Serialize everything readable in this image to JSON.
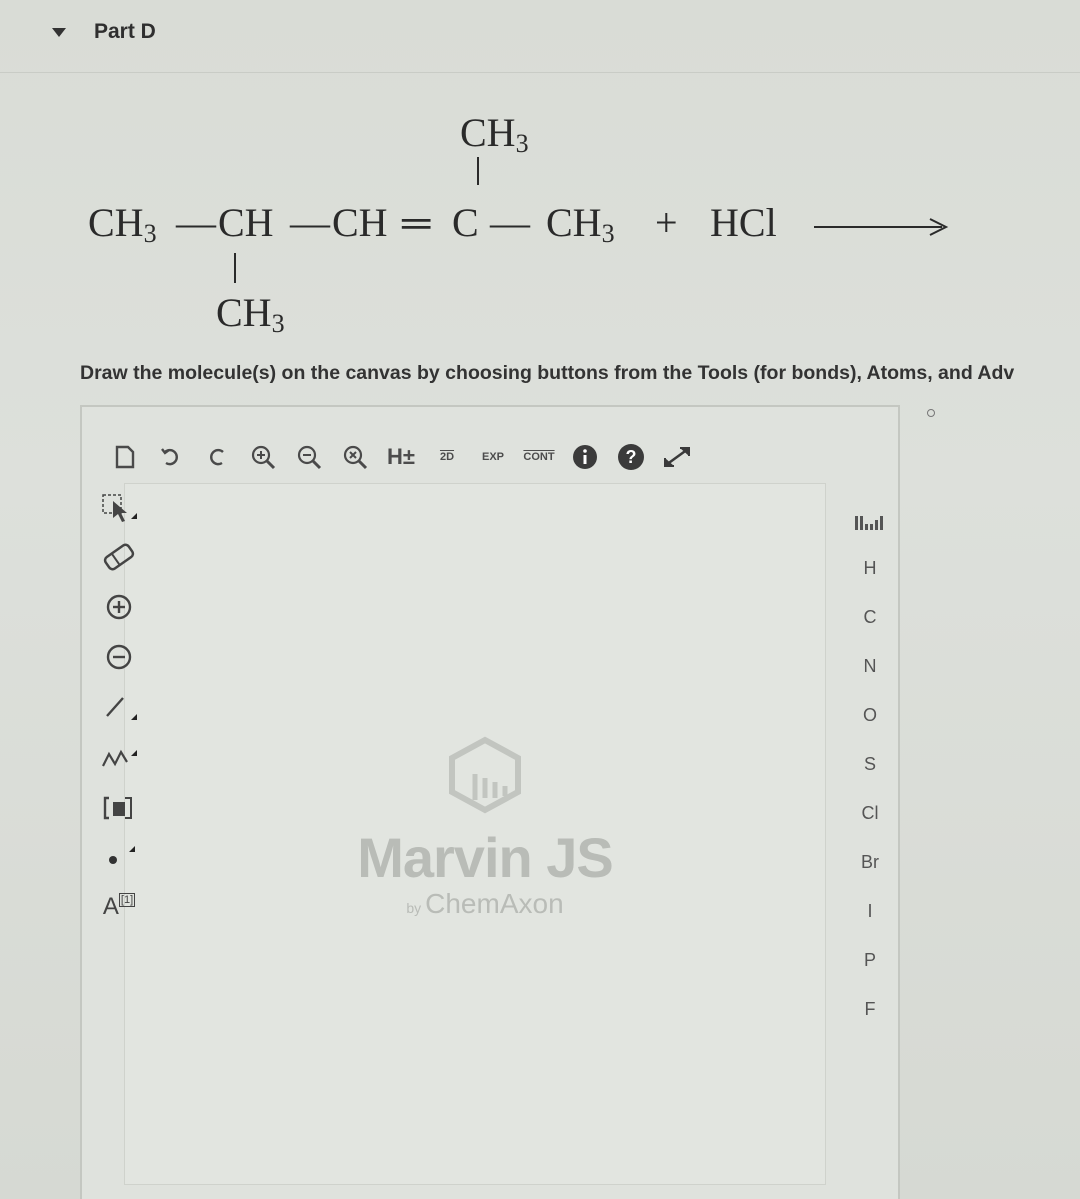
{
  "part": {
    "title": "Part D"
  },
  "reaction": {
    "top_methyl": "CH",
    "top_methyl_sub": "3",
    "main_chain": [
      {
        "text": "CH",
        "sub": "3"
      },
      {
        "text": "CH",
        "sub": ""
      },
      {
        "text": "CH",
        "sub": ""
      },
      {
        "text": "C",
        "sub": ""
      },
      {
        "text": "CH",
        "sub": "3"
      }
    ],
    "bonds": [
      "—",
      "—",
      "═",
      "—"
    ],
    "plus": "+",
    "reagent": "HCl",
    "bottom_methyl": "CH",
    "bottom_methyl_sub": "3"
  },
  "instruction": "Draw the molecule(s) on the canvas by choosing buttons from the Tools (for bonds), Atoms, and Adv",
  "toolbar": {
    "h_label": "H±",
    "clean2d_label": "2D",
    "expand_label": "EXP",
    "contract_label": "CONT"
  },
  "atoms": [
    "H",
    "C",
    "N",
    "O",
    "S",
    "Cl",
    "Br",
    "I",
    "P",
    "F"
  ],
  "left_tools": {
    "atom_label": "A",
    "atom_index": "[1]"
  },
  "watermark": {
    "title": "Marvin JS",
    "by": "by",
    "company": "ChemAxon"
  }
}
